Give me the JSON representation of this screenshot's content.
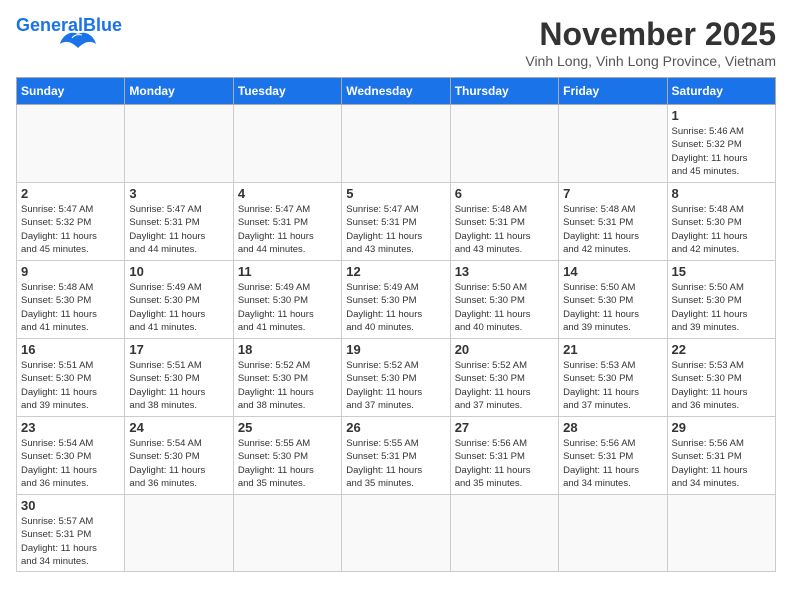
{
  "header": {
    "logo_general": "General",
    "logo_blue": "Blue",
    "month_title": "November 2025",
    "location": "Vinh Long, Vinh Long Province, Vietnam"
  },
  "days_of_week": [
    "Sunday",
    "Monday",
    "Tuesday",
    "Wednesday",
    "Thursday",
    "Friday",
    "Saturday"
  ],
  "weeks": [
    [
      {
        "day": "",
        "info": ""
      },
      {
        "day": "",
        "info": ""
      },
      {
        "day": "",
        "info": ""
      },
      {
        "day": "",
        "info": ""
      },
      {
        "day": "",
        "info": ""
      },
      {
        "day": "",
        "info": ""
      },
      {
        "day": "1",
        "info": "Sunrise: 5:46 AM\nSunset: 5:32 PM\nDaylight: 11 hours\nand 45 minutes."
      }
    ],
    [
      {
        "day": "2",
        "info": "Sunrise: 5:47 AM\nSunset: 5:32 PM\nDaylight: 11 hours\nand 45 minutes."
      },
      {
        "day": "3",
        "info": "Sunrise: 5:47 AM\nSunset: 5:31 PM\nDaylight: 11 hours\nand 44 minutes."
      },
      {
        "day": "4",
        "info": "Sunrise: 5:47 AM\nSunset: 5:31 PM\nDaylight: 11 hours\nand 44 minutes."
      },
      {
        "day": "5",
        "info": "Sunrise: 5:47 AM\nSunset: 5:31 PM\nDaylight: 11 hours\nand 43 minutes."
      },
      {
        "day": "6",
        "info": "Sunrise: 5:48 AM\nSunset: 5:31 PM\nDaylight: 11 hours\nand 43 minutes."
      },
      {
        "day": "7",
        "info": "Sunrise: 5:48 AM\nSunset: 5:31 PM\nDaylight: 11 hours\nand 42 minutes."
      },
      {
        "day": "8",
        "info": "Sunrise: 5:48 AM\nSunset: 5:30 PM\nDaylight: 11 hours\nand 42 minutes."
      }
    ],
    [
      {
        "day": "9",
        "info": "Sunrise: 5:48 AM\nSunset: 5:30 PM\nDaylight: 11 hours\nand 41 minutes."
      },
      {
        "day": "10",
        "info": "Sunrise: 5:49 AM\nSunset: 5:30 PM\nDaylight: 11 hours\nand 41 minutes."
      },
      {
        "day": "11",
        "info": "Sunrise: 5:49 AM\nSunset: 5:30 PM\nDaylight: 11 hours\nand 41 minutes."
      },
      {
        "day": "12",
        "info": "Sunrise: 5:49 AM\nSunset: 5:30 PM\nDaylight: 11 hours\nand 40 minutes."
      },
      {
        "day": "13",
        "info": "Sunrise: 5:50 AM\nSunset: 5:30 PM\nDaylight: 11 hours\nand 40 minutes."
      },
      {
        "day": "14",
        "info": "Sunrise: 5:50 AM\nSunset: 5:30 PM\nDaylight: 11 hours\nand 39 minutes."
      },
      {
        "day": "15",
        "info": "Sunrise: 5:50 AM\nSunset: 5:30 PM\nDaylight: 11 hours\nand 39 minutes."
      }
    ],
    [
      {
        "day": "16",
        "info": "Sunrise: 5:51 AM\nSunset: 5:30 PM\nDaylight: 11 hours\nand 39 minutes."
      },
      {
        "day": "17",
        "info": "Sunrise: 5:51 AM\nSunset: 5:30 PM\nDaylight: 11 hours\nand 38 minutes."
      },
      {
        "day": "18",
        "info": "Sunrise: 5:52 AM\nSunset: 5:30 PM\nDaylight: 11 hours\nand 38 minutes."
      },
      {
        "day": "19",
        "info": "Sunrise: 5:52 AM\nSunset: 5:30 PM\nDaylight: 11 hours\nand 37 minutes."
      },
      {
        "day": "20",
        "info": "Sunrise: 5:52 AM\nSunset: 5:30 PM\nDaylight: 11 hours\nand 37 minutes."
      },
      {
        "day": "21",
        "info": "Sunrise: 5:53 AM\nSunset: 5:30 PM\nDaylight: 11 hours\nand 37 minutes."
      },
      {
        "day": "22",
        "info": "Sunrise: 5:53 AM\nSunset: 5:30 PM\nDaylight: 11 hours\nand 36 minutes."
      }
    ],
    [
      {
        "day": "23",
        "info": "Sunrise: 5:54 AM\nSunset: 5:30 PM\nDaylight: 11 hours\nand 36 minutes."
      },
      {
        "day": "24",
        "info": "Sunrise: 5:54 AM\nSunset: 5:30 PM\nDaylight: 11 hours\nand 36 minutes."
      },
      {
        "day": "25",
        "info": "Sunrise: 5:55 AM\nSunset: 5:30 PM\nDaylight: 11 hours\nand 35 minutes."
      },
      {
        "day": "26",
        "info": "Sunrise: 5:55 AM\nSunset: 5:31 PM\nDaylight: 11 hours\nand 35 minutes."
      },
      {
        "day": "27",
        "info": "Sunrise: 5:56 AM\nSunset: 5:31 PM\nDaylight: 11 hours\nand 35 minutes."
      },
      {
        "day": "28",
        "info": "Sunrise: 5:56 AM\nSunset: 5:31 PM\nDaylight: 11 hours\nand 34 minutes."
      },
      {
        "day": "29",
        "info": "Sunrise: 5:56 AM\nSunset: 5:31 PM\nDaylight: 11 hours\nand 34 minutes."
      }
    ],
    [
      {
        "day": "30",
        "info": "Sunrise: 5:57 AM\nSunset: 5:31 PM\nDaylight: 11 hours\nand 34 minutes."
      },
      {
        "day": "",
        "info": ""
      },
      {
        "day": "",
        "info": ""
      },
      {
        "day": "",
        "info": ""
      },
      {
        "day": "",
        "info": ""
      },
      {
        "day": "",
        "info": ""
      },
      {
        "day": "",
        "info": ""
      }
    ]
  ]
}
